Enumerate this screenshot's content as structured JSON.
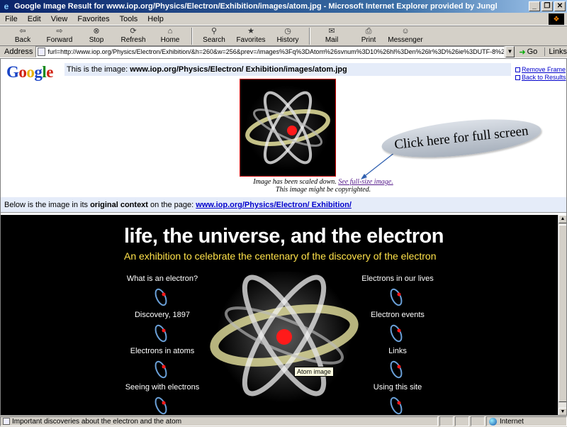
{
  "window": {
    "title": "Google Image Result for www.iop.org/Physics/Electron/Exhibition/images/atom.jpg - Microsoft Internet Explorer provided by Jungl",
    "buttons": {
      "minimize": "_",
      "maximize": "❐",
      "close": "✕"
    }
  },
  "menu": [
    "File",
    "Edit",
    "View",
    "Favorites",
    "Tools",
    "Help"
  ],
  "toolbar": [
    {
      "label": "Back",
      "icon": "back-arrow-icon",
      "glyph": "⇦"
    },
    {
      "label": "Forward",
      "icon": "forward-arrow-icon",
      "glyph": "⇨"
    },
    {
      "label": "Stop",
      "icon": "stop-icon",
      "glyph": "⊗"
    },
    {
      "label": "Refresh",
      "icon": "refresh-icon",
      "glyph": "⟳"
    },
    {
      "label": "Home",
      "icon": "home-icon",
      "glyph": "⌂"
    },
    {
      "label": "Search",
      "icon": "search-icon",
      "glyph": "⚲"
    },
    {
      "label": "Favorites",
      "icon": "favorites-icon",
      "glyph": "★"
    },
    {
      "label": "History",
      "icon": "history-icon",
      "glyph": "◷"
    },
    {
      "label": "Mail",
      "icon": "mail-icon",
      "glyph": "✉"
    },
    {
      "label": "Print",
      "icon": "print-icon",
      "glyph": "⎙"
    },
    {
      "label": "Messenger",
      "icon": "messenger-icon",
      "glyph": "☺"
    }
  ],
  "address": {
    "label": "Address",
    "value": "furl=http://www.iop.org/Physics/Electron/Exhibition/&h=260&w=256&prev=/images%3Fq%3DAtom%26svnum%3D10%26hl%3Den%26lr%3D%26ie%3DUTF-8%26oe%3DUTF-8",
    "go_label": "Go",
    "links_label": "Links"
  },
  "google": {
    "logo_letters": [
      "G",
      "o",
      "o",
      "g",
      "l",
      "e"
    ],
    "info_prefix": "This is the image:",
    "info_url": "www.iop.org/Physics/Electron/ Exhibition/images/atom.jpg",
    "remove_frame": "Remove Frame",
    "back_to_results": "Back to Results",
    "caption_prefix": "Image has been scaled down.",
    "caption_link": "See full-size image.",
    "caption_copyright": "This image might be copyrighted.",
    "context_prefix": "Below is the image in its",
    "context_bold": "original context",
    "context_mid": "on the page:",
    "context_link": "www.iop.org/Physics/Electron/ Exhibition/"
  },
  "callout": "Click here for full screen",
  "exhibition": {
    "title": "life, the universe, and the electron",
    "subtitle": "An exhibition to celebrate the centenary of the discovery of the electron",
    "left_items": [
      "What is an electron?",
      "Discovery, 1897",
      "Electrons in atoms",
      "Seeing with electrons"
    ],
    "right_items": [
      "Electrons in our lives",
      "Electron events",
      "Links",
      "Using this site"
    ],
    "tooltip": "Atom image"
  },
  "status": {
    "text": "Important discoveries about the electron and the atom",
    "zone": "Internet"
  },
  "colors": {
    "title_bar": "#0a246a",
    "nucleus": "#ff1a1a",
    "subtitle": "#ffe24a",
    "info_bar": "#e5ecf9"
  }
}
